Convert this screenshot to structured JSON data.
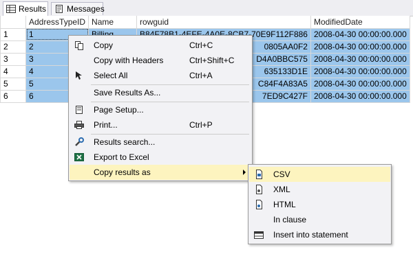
{
  "tabs": [
    {
      "label": "Results",
      "icon": "grid-icon"
    },
    {
      "label": "Messages",
      "icon": "messages-icon"
    }
  ],
  "grid": {
    "columns": [
      "",
      "AddressTypeID",
      "Name",
      "rowguid",
      "ModifiedDate"
    ],
    "rows": [
      {
        "rn": "1",
        "id": "1",
        "name": "Billing",
        "guid": "B84F78B1-4EFE-4A0E-8CB7-70E9F112F886",
        "date": "2008-04-30 00:00:00.000"
      },
      {
        "rn": "2",
        "id": "2",
        "name": "",
        "guid": "0805AA0F2",
        "date": "2008-04-30 00:00:00.000"
      },
      {
        "rn": "3",
        "id": "3",
        "name": "",
        "guid": "D4A0BBC575",
        "date": "2008-04-30 00:00:00.000"
      },
      {
        "rn": "4",
        "id": "4",
        "name": "",
        "guid": "635133D1E",
        "date": "2008-04-30 00:00:00.000"
      },
      {
        "rn": "5",
        "id": "5",
        "name": "",
        "guid": "C84F4A83A5",
        "date": "2008-04-30 00:00:00.000"
      },
      {
        "rn": "6",
        "id": "6",
        "name": "",
        "guid": "7ED9C427F",
        "date": "2008-04-30 00:00:00.000"
      }
    ]
  },
  "context_menu": {
    "items": [
      {
        "label": "Copy",
        "shortcut": "Ctrl+C",
        "icon": "copy-icon"
      },
      {
        "label": "Copy with Headers",
        "shortcut": "Ctrl+Shift+C",
        "icon": ""
      },
      {
        "label": "Select All",
        "shortcut": "Ctrl+A",
        "icon": "select-all-icon"
      },
      {
        "label": "Save Results As...",
        "shortcut": "",
        "icon": ""
      },
      {
        "label": "Page Setup...",
        "shortcut": "",
        "icon": "page-setup-icon"
      },
      {
        "label": "Print...",
        "shortcut": "Ctrl+P",
        "icon": "printer-icon"
      },
      {
        "label": "Results search...",
        "shortcut": "",
        "icon": "wrench-icon"
      },
      {
        "label": "Export to Excel",
        "shortcut": "",
        "icon": "excel-icon"
      },
      {
        "label": "Copy results as",
        "shortcut": "",
        "icon": ""
      }
    ]
  },
  "submenu": {
    "items": [
      {
        "label": "CSV",
        "icon": "csv-file-icon"
      },
      {
        "label": "XML",
        "icon": "xml-file-icon"
      },
      {
        "label": "HTML",
        "icon": "html-file-icon"
      },
      {
        "label": "In clause",
        "icon": ""
      },
      {
        "label": "Insert into statement",
        "icon": "table-icon"
      }
    ]
  },
  "colors": {
    "selection": "#9bc6ec",
    "highlight": "#fdf4bf",
    "menu_bg": "#f2f2f5"
  }
}
